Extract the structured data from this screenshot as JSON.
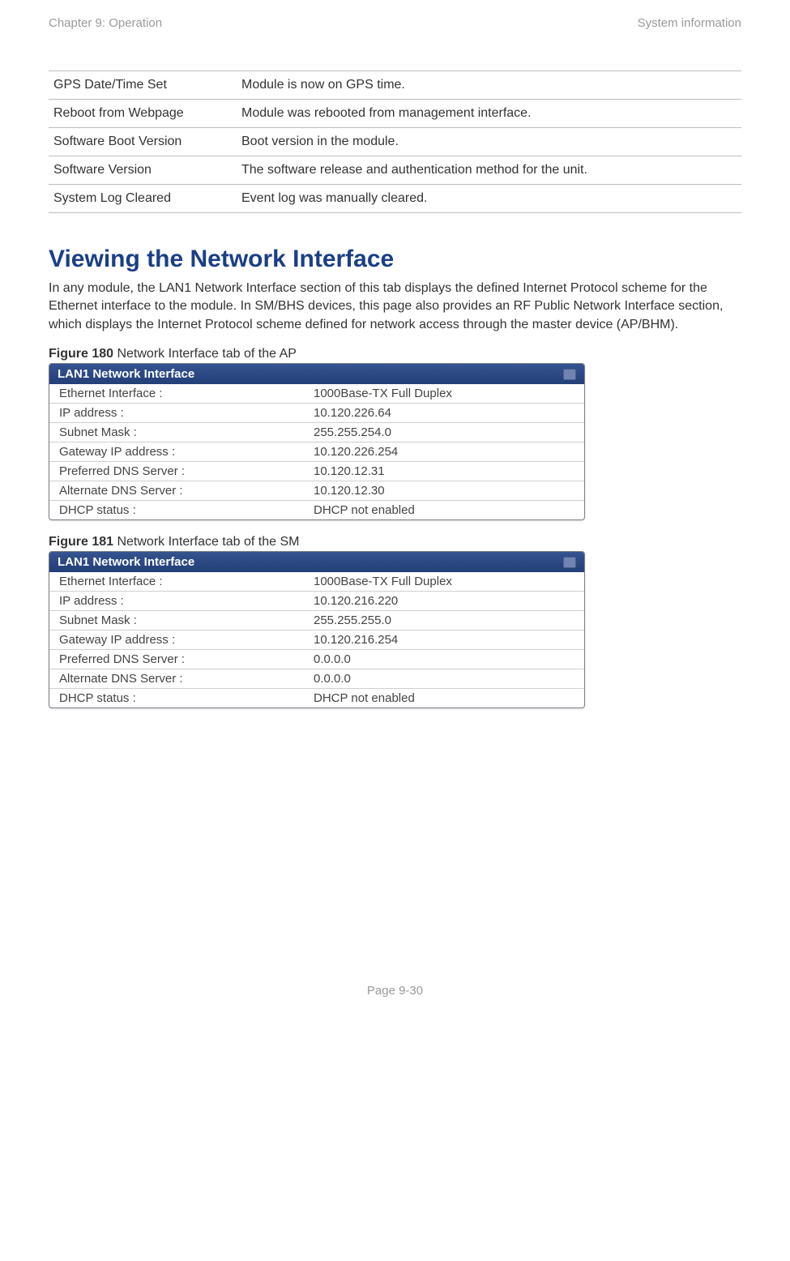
{
  "header": {
    "left": "Chapter 9:  Operation",
    "right": "System information"
  },
  "def_rows": [
    {
      "term": "GPS Date/Time Set",
      "desc": "Module is now on GPS time."
    },
    {
      "term": "Reboot from Webpage",
      "desc": "Module was rebooted from management interface."
    },
    {
      "term": "Software Boot Version",
      "desc": "Boot version in the module."
    },
    {
      "term": "Software Version",
      "desc": "The software release and authentication method for the unit."
    },
    {
      "term": "System Log Cleared",
      "desc": "Event log was manually cleared."
    }
  ],
  "section_title": "Viewing the Network Interface",
  "section_body": "In any module, the LAN1 Network Interface section of this tab displays the defined Internet Protocol scheme for the Ethernet interface to the module. In SM/BHS devices, this page also provides an RF Public Network Interface section, which displays the Internet Protocol scheme defined for network access through the master device (AP/BHM).",
  "figures": [
    {
      "caption_bold": "Figure 180",
      "caption_rest": " Network Interface tab of the AP",
      "panel_title": "LAN1 Network Interface",
      "rows": [
        {
          "label": "Ethernet Interface :",
          "value": "1000Base-TX Full Duplex"
        },
        {
          "label": "IP address :",
          "value": "10.120.226.64"
        },
        {
          "label": "Subnet Mask :",
          "value": "255.255.254.0"
        },
        {
          "label": "Gateway IP address :",
          "value": "10.120.226.254"
        },
        {
          "label": "Preferred DNS Server :",
          "value": "10.120.12.31"
        },
        {
          "label": "Alternate DNS Server :",
          "value": "10.120.12.30"
        },
        {
          "label": "DHCP status :",
          "value": "DHCP not enabled"
        }
      ]
    },
    {
      "caption_bold": "Figure 181",
      "caption_rest": " Network Interface tab of the SM",
      "panel_title": "LAN1 Network Interface",
      "rows": [
        {
          "label": "Ethernet Interface :",
          "value": "1000Base-TX Full Duplex"
        },
        {
          "label": "IP address :",
          "value": "10.120.216.220"
        },
        {
          "label": "Subnet Mask :",
          "value": "255.255.255.0"
        },
        {
          "label": "Gateway IP address :",
          "value": "10.120.216.254"
        },
        {
          "label": "Preferred DNS Server :",
          "value": "0.0.0.0"
        },
        {
          "label": "Alternate DNS Server :",
          "value": "0.0.0.0"
        },
        {
          "label": "DHCP status :",
          "value": "DHCP not enabled"
        }
      ]
    }
  ],
  "footer": "Page 9-30"
}
